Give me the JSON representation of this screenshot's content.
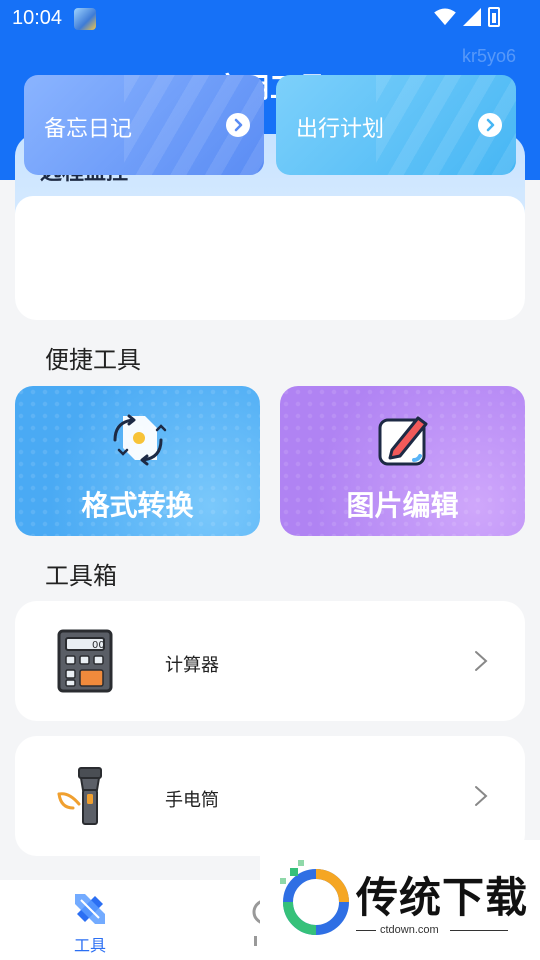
{
  "status": {
    "time": "10:04"
  },
  "watermark": "kr5yo6",
  "header": {
    "title": "实用工具"
  },
  "remote": {
    "title": "远程监控",
    "tiles": [
      {
        "label": "备忘日记"
      },
      {
        "label": "出行计划"
      }
    ]
  },
  "quick": {
    "title": "便捷工具",
    "cards": [
      {
        "label": "格式转换",
        "icon": "convert-icon"
      },
      {
        "label": "图片编辑",
        "icon": "image-edit-icon"
      }
    ]
  },
  "toolbox": {
    "title": "工具箱",
    "items": [
      {
        "label": "计算器",
        "icon": "calculator-icon"
      },
      {
        "label": "手电筒",
        "icon": "flashlight-icon"
      }
    ]
  },
  "tabbar": {
    "tabs": [
      {
        "label": "工具"
      }
    ]
  },
  "ad": {
    "title": "传统下载",
    "url": "ctdown.com"
  },
  "colors": {
    "primary": "#1671f7",
    "accent_blue": "#4aaaf4",
    "accent_purple": "#b083f3"
  }
}
